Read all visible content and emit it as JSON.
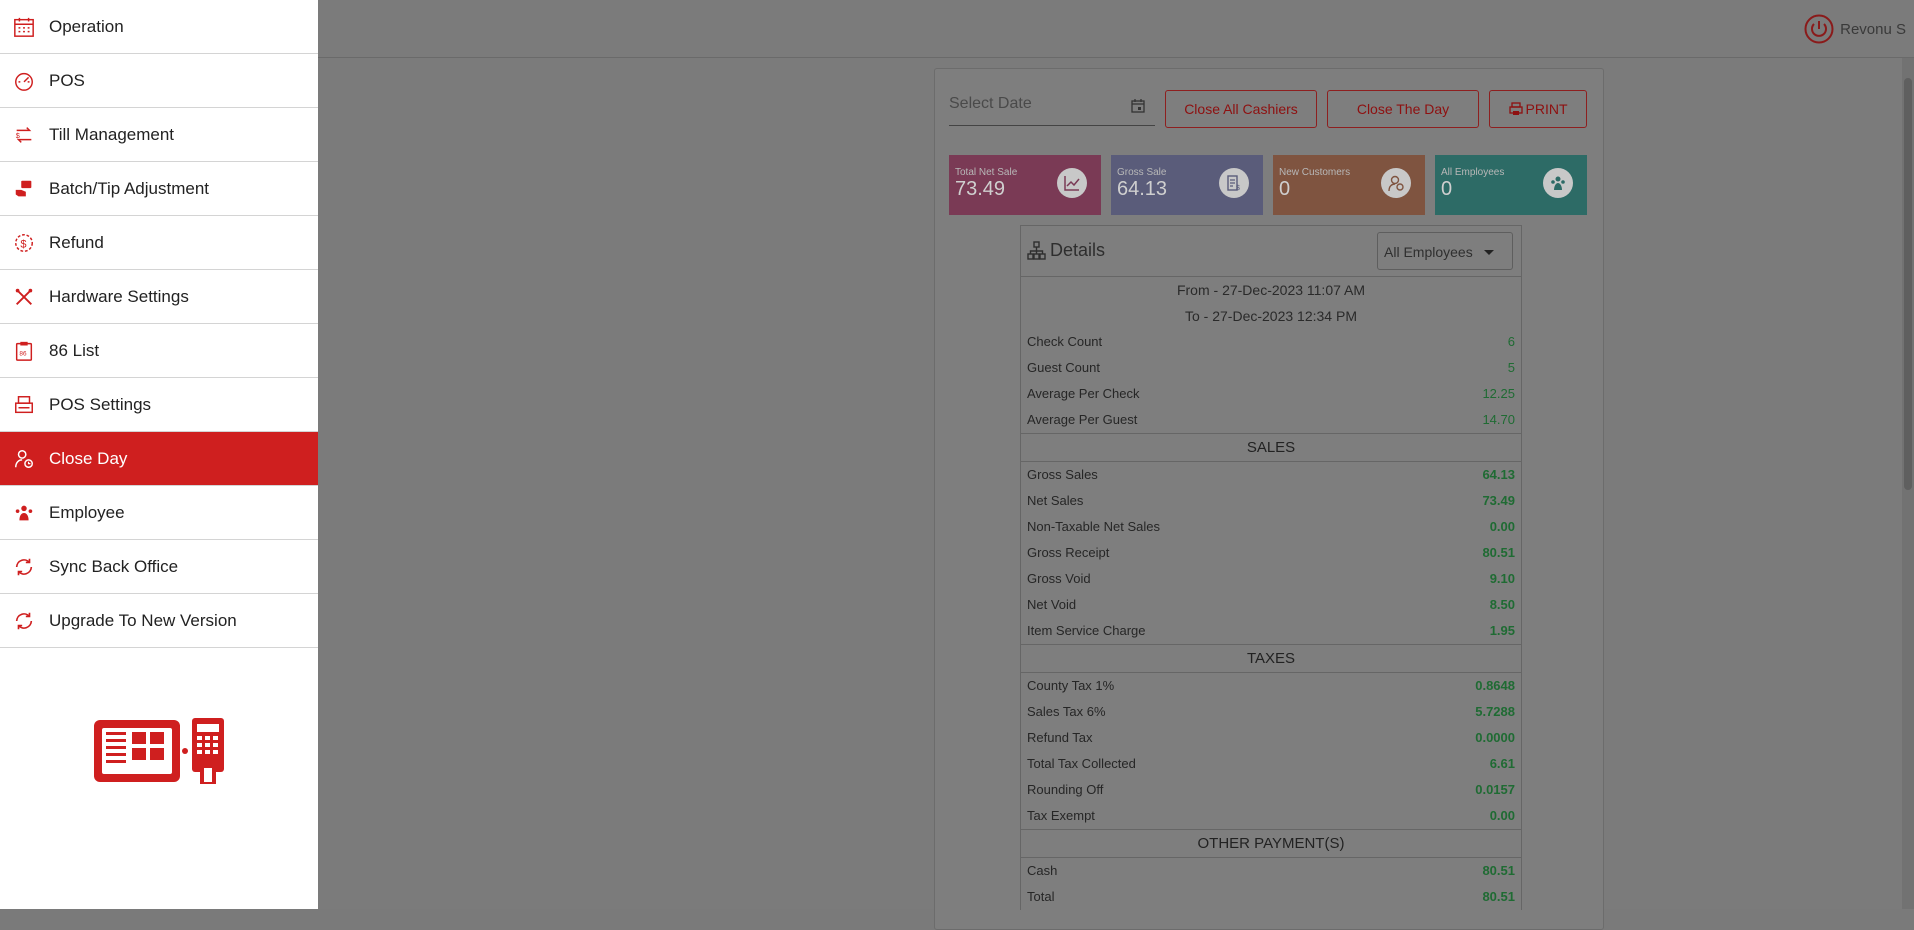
{
  "sidebar": {
    "items": [
      {
        "label": "Operation",
        "icon": "calendar-icon"
      },
      {
        "label": "POS",
        "icon": "gauge-icon"
      },
      {
        "label": "Till Management",
        "icon": "transfer-icon"
      },
      {
        "label": "Batch/Tip Adjustment",
        "icon": "hand-card-icon"
      },
      {
        "label": "Refund",
        "icon": "refund-icon"
      },
      {
        "label": "Hardware Settings",
        "icon": "tools-icon"
      },
      {
        "label": "86 List",
        "icon": "clipboard-icon"
      },
      {
        "label": "POS Settings",
        "icon": "printer-icon"
      },
      {
        "label": "Close Day",
        "icon": "user-clock-icon",
        "active": true
      },
      {
        "label": "Employee",
        "icon": "employees-icon"
      },
      {
        "label": "Sync Back Office",
        "icon": "sync-icon"
      },
      {
        "label": "Upgrade To New Version",
        "icon": "sync-icon"
      }
    ]
  },
  "header": {
    "user_name": "Revonu S"
  },
  "toolbar": {
    "date_placeholder": "Select Date",
    "close_all_cashiers": "Close All Cashiers",
    "close_the_day": "Close The Day",
    "print": "PRINT"
  },
  "stats": [
    {
      "label": "Total Net Sale",
      "value": "73.49",
      "icon": "chart-line-icon"
    },
    {
      "label": "Gross Sale",
      "value": "64.13",
      "icon": "receipt-icon"
    },
    {
      "label": "New Customers",
      "value": "0",
      "icon": "user-icon"
    },
    {
      "label": "All Employees",
      "value": "0",
      "icon": "employees-icon"
    }
  ],
  "details": {
    "title": "Details",
    "employee_filter": "All Employees",
    "from": "From - 27-Dec-2023 11:07 AM",
    "to": "To - 27-Dec-2023 12:34 PM",
    "summary": [
      {
        "label": "Check Count",
        "value": "6"
      },
      {
        "label": "Guest Count",
        "value": "5"
      },
      {
        "label": "Average Per Check",
        "value": "12.25"
      },
      {
        "label": "Average Per Guest",
        "value": "14.70"
      }
    ],
    "sales_title": "SALES",
    "sales": [
      {
        "label": "Gross Sales",
        "value": "64.13"
      },
      {
        "label": "Net Sales",
        "value": "73.49"
      },
      {
        "label": "Non-Taxable Net Sales",
        "value": "0.00"
      },
      {
        "label": "Gross Receipt",
        "value": "80.51"
      },
      {
        "label": "Gross Void",
        "value": "9.10"
      },
      {
        "label": "Net Void",
        "value": "8.50"
      },
      {
        "label": "Item Service Charge",
        "value": "1.95"
      }
    ],
    "taxes_title": "TAXES",
    "taxes": [
      {
        "label": "County Tax 1%",
        "value": "0.8648"
      },
      {
        "label": "Sales Tax 6%",
        "value": "5.7288"
      },
      {
        "label": "Refund Tax",
        "value": "0.0000"
      },
      {
        "label": "Total Tax Collected",
        "value": "6.61"
      },
      {
        "label": "Rounding Off",
        "value": "0.0157"
      },
      {
        "label": "Tax Exempt",
        "value": "0.00"
      }
    ],
    "payments_title": "OTHER PAYMENT(S)",
    "payments": [
      {
        "label": "Cash",
        "value": "80.51"
      },
      {
        "label": "Total",
        "value": "80.51"
      }
    ]
  },
  "colors": {
    "accent": "#cf1f1f",
    "value_green": "#1f6b33"
  }
}
